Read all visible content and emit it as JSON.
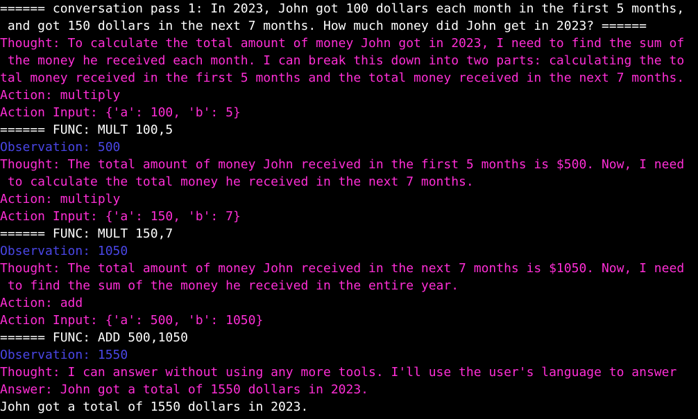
{
  "colors": {
    "background": "#000000",
    "default_text": "#ffffff",
    "magenta": "#ff2ed6",
    "blue": "#4a46e6"
  },
  "terminal": {
    "lines": [
      "====== conversation pass 1: In 2023, John got 100 dollars each month in the first 5 months,",
      " and got 150 dollars in the next 7 months. How much money did John get in 2023? ======",
      "Thought: To calculate the total amount of money John got in 2023, I need to find the sum of",
      " the money he received each month. I can break this down into two parts: calculating the to",
      "tal money received in the first 5 months and the total money received in the next 7 months.",
      "Action: multiply",
      "Action Input: {'a': 100, 'b': 5}",
      "====== FUNC: MULT 100,5",
      "Observation: 500",
      "Thought: The total amount of money John received in the first 5 months is $500. Now, I need",
      " to calculate the total money he received in the next 7 months.",
      "Action: multiply",
      "Action Input: {'a': 150, 'b': 7}",
      "====== FUNC: MULT 150,7",
      "Observation: 1050",
      "Thought: The total amount of money John received in the next 7 months is $1050. Now, I need",
      " to find the sum of the money he received in the entire year.",
      "Action: add",
      "Action Input: {'a': 500, 'b': 1050}",
      "====== FUNC: ADD 500,1050",
      "Observation: 1550",
      "Thought: I can answer without using any more tools. I'll use the user's language to answer",
      "Answer: John got a total of 1550 dollars in 2023.",
      "John got a total of 1550 dollars in 2023."
    ]
  }
}
